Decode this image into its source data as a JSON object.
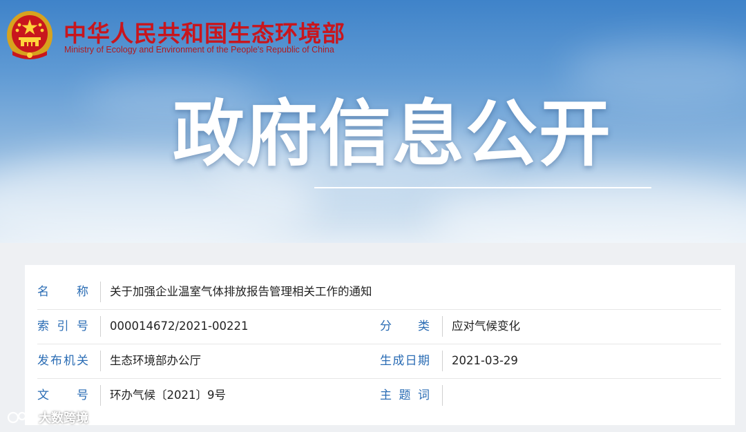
{
  "header": {
    "ministry_name_cn": "中华人民共和国生态环境部",
    "ministry_name_en": "Ministry of Ecology and Environment of the People's Republic of China",
    "banner_title": "政府信息公开"
  },
  "info": {
    "name_label": "名　　称",
    "name_value": "关于加强企业温室气体排放报告管理相关工作的通知",
    "index_label": "索引号",
    "index_value": "000014672/2021-00221",
    "category_label": "分　　类",
    "category_value": "应对气候变化",
    "issuer_label": "发布机关",
    "issuer_value": "生态环境部办公厅",
    "date_label": "生成日期",
    "date_value": "2021-03-29",
    "doc_no_label": "文　　号",
    "doc_no_value": "环办气候〔2021〕9号",
    "keywords_label": "主题词",
    "keywords_value": ""
  },
  "watermark": {
    "text": "大数跨境"
  },
  "colors": {
    "ministry_red": "#c8161d",
    "label_blue": "#2a6cb4",
    "banner_sky": "#5f9ad4"
  },
  "icons": {
    "emblem": "national-emblem-icon",
    "watermark": "watermark-logo-icon"
  }
}
